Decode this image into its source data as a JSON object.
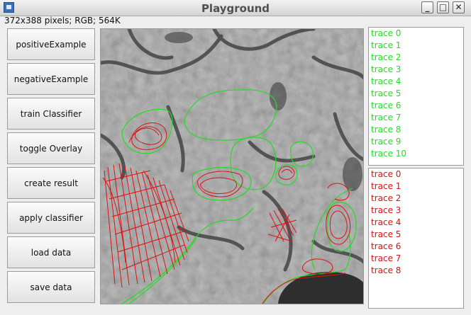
{
  "window": {
    "title": "Playground"
  },
  "image_info": "372x388 pixels; RGB; 564K",
  "window_controls": [
    "_",
    "□",
    "✕"
  ],
  "buttons": [
    "positiveExample",
    "negativeExample",
    "train Classifier",
    "toggle Overlay",
    "create result",
    "apply classifier",
    "load data",
    "save data"
  ],
  "positive_traces": {
    "color": "#22dd22",
    "items": [
      "trace 0",
      "trace 1",
      "trace 2",
      "trace 3",
      "trace 4",
      "trace 5",
      "trace 6",
      "trace 7",
      "trace 8",
      "trace 9",
      "trace 10"
    ]
  },
  "negative_traces": {
    "color": "#dd1111",
    "items": [
      "trace 0",
      "trace 1",
      "trace 2",
      "trace 3",
      "trace 4",
      "trace 5",
      "trace 6",
      "trace 7",
      "trace 8"
    ]
  }
}
